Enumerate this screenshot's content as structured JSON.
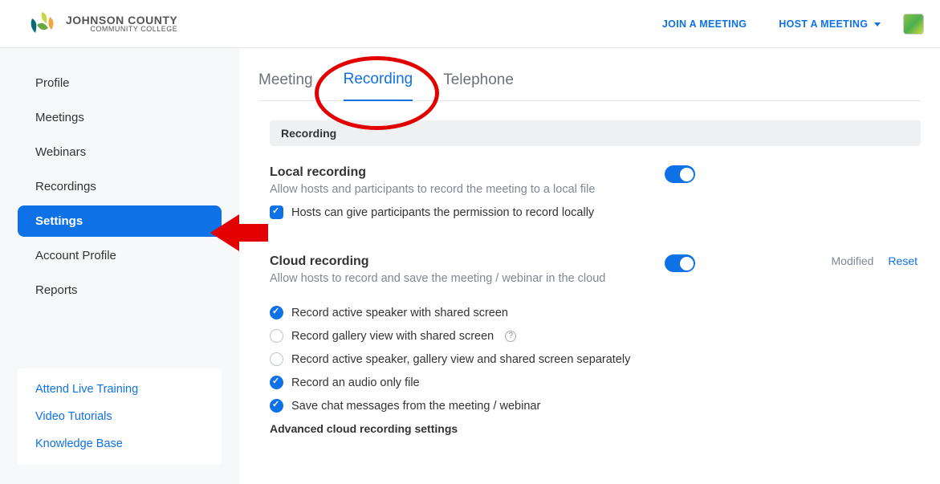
{
  "header": {
    "brand_line1": "JOHNSON COUNTY",
    "brand_line2": "COMMUNITY COLLEGE",
    "join_link": "JOIN A MEETING",
    "host_link": "HOST A MEETING"
  },
  "sidebar": {
    "items": [
      {
        "label": "Profile"
      },
      {
        "label": "Meetings"
      },
      {
        "label": "Webinars"
      },
      {
        "label": "Recordings"
      },
      {
        "label": "Settings"
      },
      {
        "label": "Account Profile"
      },
      {
        "label": "Reports"
      }
    ],
    "help": [
      {
        "label": "Attend Live Training"
      },
      {
        "label": "Video Tutorials"
      },
      {
        "label": "Knowledge Base"
      }
    ]
  },
  "tabs": {
    "t1": "Meeting",
    "t2": "Recording",
    "t3": "Telephone"
  },
  "section_header": "Recording",
  "local": {
    "title": "Local recording",
    "desc": "Allow hosts and participants to record the meeting to a local file",
    "opt1": "Hosts can give participants the permission to record locally"
  },
  "cloud": {
    "title": "Cloud recording",
    "desc": "Allow hosts to record and save the meeting / webinar in the cloud",
    "modified": "Modified",
    "reset": "Reset",
    "opt1": "Record active speaker with shared screen",
    "opt2": "Record gallery view with shared screen",
    "opt3": "Record active speaker, gallery view and shared screen separately",
    "opt4": "Record an audio only file",
    "opt5": "Save chat messages from the meeting / webinar",
    "advanced": "Advanced cloud recording settings"
  }
}
